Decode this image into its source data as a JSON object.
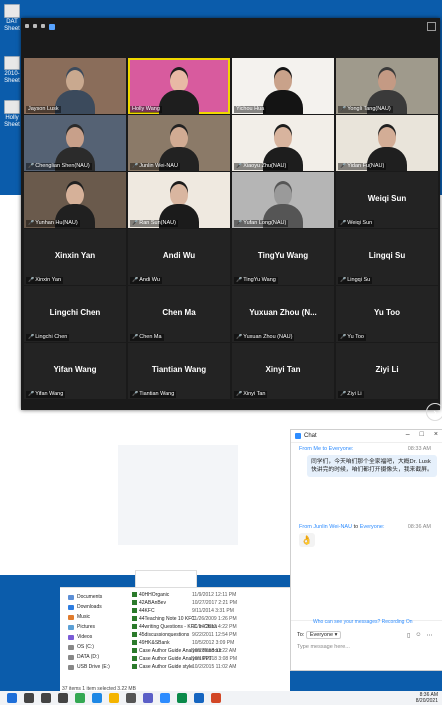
{
  "desktop_icons": [
    "DAT Sheet",
    "2010-Sheet",
    "Holly Sheet"
  ],
  "gallery": {
    "tiles": [
      {
        "name": "Jayson Lusk",
        "muted": false,
        "video": true,
        "colors": [
          "#c9a98f",
          "#3b4a5c",
          "#8a6d5a"
        ]
      },
      {
        "name": "Holly Wang",
        "muted": false,
        "video": true,
        "active": true,
        "colors": [
          "#e8b9a5",
          "#1e1e1e",
          "#d85b9e"
        ]
      },
      {
        "name": "Yichou Hua",
        "muted": false,
        "video": true,
        "colors": [
          "#c9a28a",
          "#141414",
          "#f4f2ee"
        ]
      },
      {
        "name": "Yongli Tang(NAU)",
        "muted": true,
        "video": true,
        "colors": [
          "#c49a84",
          "#3a3a3a",
          "#9f9a8c"
        ]
      },
      {
        "name": "Chenglian Shen(NAU)",
        "muted": true,
        "video": true,
        "colors": [
          "#c8a08a",
          "#2b2b2b",
          "#556274"
        ]
      },
      {
        "name": "Junlin Wei-NAU",
        "muted": true,
        "video": true,
        "colors": [
          "#d1ab93",
          "#222",
          "#8b7a68"
        ]
      },
      {
        "name": "Xiaoyu Zhu(NAU)",
        "muted": true,
        "video": true,
        "colors": [
          "#d8b49e",
          "#1d1d1d",
          "#f2eee8"
        ]
      },
      {
        "name": "Yidan Fu(NAU)",
        "muted": true,
        "video": true,
        "colors": [
          "#d3ad96",
          "#1f1f1f",
          "#e9e4da"
        ]
      },
      {
        "name": "Yunhan Hu(NAU)",
        "muted": true,
        "video": true,
        "colors": [
          "#d6b199",
          "#202020",
          "#6a5a4c"
        ]
      },
      {
        "name": "Ran Sun(NAU)",
        "muted": true,
        "video": true,
        "colors": [
          "#d9b6a0",
          "#1b1b1b",
          "#efe9e0"
        ]
      },
      {
        "name": "Yufan Long(NAU)",
        "muted": true,
        "video": true,
        "colors": [
          "#9a9a9a",
          "#555",
          "#b5b5b5"
        ]
      },
      {
        "name": "Weiqi Sun",
        "label": "Weiqi Sun",
        "muted": true,
        "video": false
      },
      {
        "name": "Xinxin Yan",
        "label": "Xinxin Yan",
        "muted": true,
        "video": false
      },
      {
        "name": "Andi Wu",
        "label": "Andi Wu",
        "muted": true,
        "video": false
      },
      {
        "name": "TingYu Wang",
        "label": "TingYu Wang",
        "muted": true,
        "video": false
      },
      {
        "name": "Lingqi Su",
        "label": "Lingqi Su",
        "muted": true,
        "video": false
      },
      {
        "name": "Lingchi Chen",
        "label": "Lingchi Chen",
        "muted": true,
        "video": false
      },
      {
        "name": "Chen Ma",
        "label": "Chen Ma",
        "muted": true,
        "video": false
      },
      {
        "name": "Yuxuan Zhou (NAU)",
        "label": "Yuxuan  Zhou  (N...",
        "muted": true,
        "video": false
      },
      {
        "name": "Yu Too",
        "label": "Yu Too",
        "muted": true,
        "video": false
      },
      {
        "name": "Yifan Wang",
        "label": "Yifan Wang",
        "muted": true,
        "video": false
      },
      {
        "name": "Tiantian Wang",
        "label": "Tiantian Wang",
        "muted": true,
        "video": false
      },
      {
        "name": "Xinyi Tan",
        "label": "Xinyi Tan",
        "muted": true,
        "video": false
      },
      {
        "name": "Ziyi Li",
        "label": "Ziyi Li",
        "muted": true,
        "video": false
      }
    ],
    "next_glyph": "›"
  },
  "chat": {
    "title": "Chat",
    "win_min": "–",
    "win_max": "□",
    "win_close": "×",
    "msg1": {
      "from": "From Me to Everyone:",
      "time": "08:33 AM",
      "text": "同学们，今天咱们那个全家福吧，大概Dr. Lusk 快讲完的时候，咱们都打开摄像头，我来截屏。"
    },
    "msg2": {
      "from_name": "From Junlin Wei-NAU",
      "to_word": "to",
      "to_name": "Everyone:",
      "time": "08:36 AM",
      "emoji": "👌"
    },
    "who_can_see": "Who can see your messages? Recording On",
    "to_label": "To:",
    "to_value": "Everyone ▾",
    "placeholder": "Type message here..."
  },
  "explorer": {
    "nav": [
      {
        "label": "Documents",
        "color": "#5c8fd6"
      },
      {
        "label": "Downloads",
        "color": "#2d7de0"
      },
      {
        "label": "Music",
        "color": "#e07b2d"
      },
      {
        "label": "Pictures",
        "color": "#5ca0d6"
      },
      {
        "label": "Videos",
        "color": "#7a5cd6"
      },
      {
        "label": "OS (C:)",
        "color": "#888"
      },
      {
        "label": "DATA (D:)",
        "color": "#888"
      },
      {
        "label": "USB Drive (E:)",
        "color": "#888"
      }
    ],
    "files": [
      {
        "name": "40HHOrganic",
        "date": "11/9/2012 12:11 PM"
      },
      {
        "name": "42ABAnBev",
        "date": "10/27/2017 2:21 PM"
      },
      {
        "name": "44KFC",
        "date": "9/11/2014 3:31 PM"
      },
      {
        "name": "44Teaching Note 10 KFC",
        "date": "11/26/2009 1:26 PM"
      },
      {
        "name": "44writing Questions - KFC in China",
        "date": "11/14/2012 4:22 PM"
      },
      {
        "name": "45discussionquestions",
        "date": "9/22/2011 12:54 PM"
      },
      {
        "name": "49HK&SBank",
        "date": "10/5/2012 3:09 PM"
      },
      {
        "name": "Case Author Guide Analysis Handout",
        "date": "10/2/2015 11:22 AM"
      },
      {
        "name": "Case Author Guide Analysis PPT",
        "date": "10/10/2018 3:08 PM"
      },
      {
        "name": "Case Author Guide style",
        "date": "10/2/2015 11:02 AM"
      }
    ],
    "status": "37 items    1 item selected  3.22 MB"
  },
  "taskbar": {
    "time": "8:36 AM",
    "date": "8/20/2021",
    "icons": [
      "windows-icon",
      "search-icon",
      "cortana-icon",
      "task-view-icon",
      "chrome-icon",
      "edge-icon",
      "explorer-icon",
      "store-icon",
      "teams-icon",
      "zoom-icon",
      "maps-icon",
      "outlook-icon",
      "powerpoint-icon"
    ]
  }
}
